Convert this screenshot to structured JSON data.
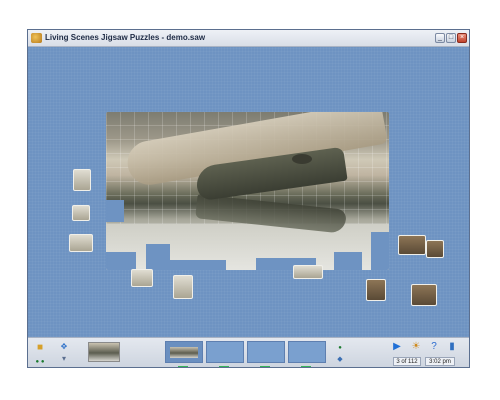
{
  "window": {
    "title": "Living Scenes Jigsaw Puzzles - demo.saw",
    "controls": {
      "minimize": "_",
      "maximize": "□",
      "close": "×"
    }
  },
  "status": {
    "piece_counter": "3 of 112",
    "clock": "3:02 pm"
  },
  "toolbar_icons": [
    "open-folder-icon",
    "scatter-pieces-icon",
    "play-icon",
    "hint-icon",
    "help-icon",
    "exit-icon"
  ],
  "colors": {
    "canvas": "#6e93c2",
    "titlebar": "#dde2ea",
    "close_button": "#c0422c",
    "tray": "#7aa0cf",
    "indicator_green": "#35b35a"
  }
}
